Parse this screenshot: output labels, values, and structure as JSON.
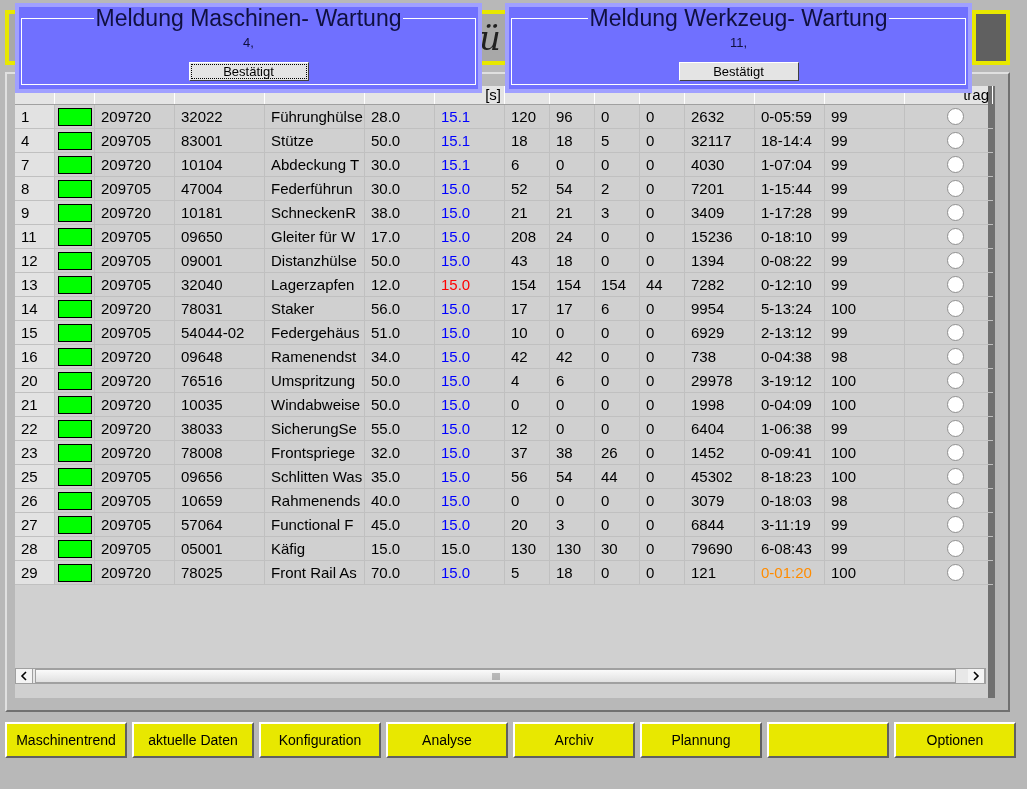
{
  "header": {
    "title": "ü"
  },
  "dialogs": [
    {
      "title": "Meldung Maschinen- Wartung",
      "message": "4,",
      "button": "Bestätigt",
      "focused": true
    },
    {
      "title": "Meldung Werkzeug- Wartung",
      "message": "11,",
      "button": "Bestätigt",
      "focused": false
    }
  ],
  "table": {
    "columns": [
      {},
      {},
      {},
      {},
      {},
      {},
      {
        "label": "[s]"
      },
      {},
      {},
      {},
      {},
      {},
      {},
      {},
      {
        "label": "trag"
      }
    ],
    "rows": [
      {
        "cells": [
          {
            "text": "1"
          },
          {
            "text": "209720"
          },
          {
            "text": "32022"
          },
          {
            "text": "Führunghülse"
          },
          {
            "text": "28.0"
          },
          {
            "text": "15.1",
            "color": "#0000ff"
          },
          {
            "text": "120"
          },
          {
            "text": "96"
          },
          {
            "text": "0"
          },
          {
            "text": "0"
          },
          {
            "text": "2632"
          },
          {
            "text": "0-05:59"
          },
          {
            "text": "99"
          }
        ],
        "indicator": {
          "color": "#00ff00"
        },
        "selected": false
      },
      {
        "cells": [
          {
            "text": "4"
          },
          {
            "text": "209705"
          },
          {
            "text": "83001"
          },
          {
            "text": "Stütze"
          },
          {
            "text": "50.0"
          },
          {
            "text": "15.1",
            "color": "#0000ff"
          },
          {
            "text": "18"
          },
          {
            "text": "18"
          },
          {
            "text": "5"
          },
          {
            "text": "0"
          },
          {
            "text": "32117"
          },
          {
            "text": "18-14:4"
          },
          {
            "text": "99"
          }
        ],
        "indicator": {
          "color": "#00ff00"
        },
        "selected": false
      },
      {
        "cells": [
          {
            "text": "7"
          },
          {
            "text": "209720"
          },
          {
            "text": "10104"
          },
          {
            "text": "Abdeckung T"
          },
          {
            "text": "30.0"
          },
          {
            "text": "15.1",
            "color": "#0000ff"
          },
          {
            "text": "6"
          },
          {
            "text": "0"
          },
          {
            "text": "0"
          },
          {
            "text": "0"
          },
          {
            "text": "4030"
          },
          {
            "text": "1-07:04"
          },
          {
            "text": "99"
          }
        ],
        "indicator": {
          "color": "#00ff00"
        },
        "selected": false
      },
      {
        "cells": [
          {
            "text": "8"
          },
          {
            "text": "209705"
          },
          {
            "text": "47004"
          },
          {
            "text": "Federführun"
          },
          {
            "text": "30.0"
          },
          {
            "text": "15.0",
            "color": "#0000ff"
          },
          {
            "text": "52"
          },
          {
            "text": "54"
          },
          {
            "text": "2"
          },
          {
            "text": "0"
          },
          {
            "text": "7201"
          },
          {
            "text": "1-15:44"
          },
          {
            "text": "99"
          }
        ],
        "indicator": {
          "color": "#00ff00"
        },
        "selected": false
      },
      {
        "cells": [
          {
            "text": "9"
          },
          {
            "text": "209720"
          },
          {
            "text": "10181"
          },
          {
            "text": "SchneckenR"
          },
          {
            "text": "38.0"
          },
          {
            "text": "15.0",
            "color": "#0000ff"
          },
          {
            "text": "21"
          },
          {
            "text": "21"
          },
          {
            "text": "3"
          },
          {
            "text": "0"
          },
          {
            "text": "3409"
          },
          {
            "text": "1-17:28"
          },
          {
            "text": "99"
          }
        ],
        "indicator": {
          "color": "#00ff00"
        },
        "selected": false
      },
      {
        "cells": [
          {
            "text": "11"
          },
          {
            "text": "209705"
          },
          {
            "text": "09650"
          },
          {
            "text": "Gleiter für W"
          },
          {
            "text": "17.0"
          },
          {
            "text": "15.0",
            "color": "#0000ff"
          },
          {
            "text": "208"
          },
          {
            "text": "24"
          },
          {
            "text": "0"
          },
          {
            "text": "0"
          },
          {
            "text": "15236"
          },
          {
            "text": "0-18:10"
          },
          {
            "text": "99"
          }
        ],
        "indicator": {
          "color": "#00ff00"
        },
        "selected": false
      },
      {
        "cells": [
          {
            "text": "12"
          },
          {
            "text": "209705"
          },
          {
            "text": "09001"
          },
          {
            "text": "Distanzhülse"
          },
          {
            "text": "50.0"
          },
          {
            "text": "15.0",
            "color": "#0000ff"
          },
          {
            "text": "43"
          },
          {
            "text": "18"
          },
          {
            "text": "0"
          },
          {
            "text": "0"
          },
          {
            "text": "1394"
          },
          {
            "text": "0-08:22"
          },
          {
            "text": "99"
          }
        ],
        "indicator": {
          "color": "#00ff00"
        },
        "selected": false
      },
      {
        "cells": [
          {
            "text": "13"
          },
          {
            "text": "209705"
          },
          {
            "text": "32040"
          },
          {
            "text": "Lagerzapfen"
          },
          {
            "text": "12.0"
          },
          {
            "text": "15.0",
            "color": "#ff0000"
          },
          {
            "text": "154"
          },
          {
            "text": "154"
          },
          {
            "text": "154"
          },
          {
            "text": "44"
          },
          {
            "text": "7282"
          },
          {
            "text": "0-12:10"
          },
          {
            "text": "99"
          }
        ],
        "indicator": {
          "color": "#00ff00"
        },
        "selected": false
      },
      {
        "cells": [
          {
            "text": "14"
          },
          {
            "text": "209720"
          },
          {
            "text": "78031"
          },
          {
            "text": "Staker"
          },
          {
            "text": "56.0"
          },
          {
            "text": "15.0",
            "color": "#0000ff"
          },
          {
            "text": "17"
          },
          {
            "text": "17"
          },
          {
            "text": "6"
          },
          {
            "text": "0"
          },
          {
            "text": "9954"
          },
          {
            "text": "5-13:24"
          },
          {
            "text": "100"
          }
        ],
        "indicator": {
          "color": "#00ff00"
        },
        "selected": false
      },
      {
        "cells": [
          {
            "text": "15"
          },
          {
            "text": "209705"
          },
          {
            "text": "54044-02"
          },
          {
            "text": "Federgehäus"
          },
          {
            "text": "51.0"
          },
          {
            "text": "15.0",
            "color": "#0000ff"
          },
          {
            "text": "10"
          },
          {
            "text": "0"
          },
          {
            "text": "0"
          },
          {
            "text": "0"
          },
          {
            "text": "6929"
          },
          {
            "text": "2-13:12"
          },
          {
            "text": "99"
          }
        ],
        "indicator": {
          "color": "#00ff00"
        },
        "selected": false
      },
      {
        "cells": [
          {
            "text": "16"
          },
          {
            "text": "209720"
          },
          {
            "text": "09648"
          },
          {
            "text": "Ramenendst"
          },
          {
            "text": "34.0"
          },
          {
            "text": "15.0",
            "color": "#0000ff"
          },
          {
            "text": "42"
          },
          {
            "text": "42"
          },
          {
            "text": "0"
          },
          {
            "text": "0"
          },
          {
            "text": "738"
          },
          {
            "text": "0-04:38"
          },
          {
            "text": "98"
          }
        ],
        "indicator": {
          "color": "#00ff00"
        },
        "selected": false
      },
      {
        "cells": [
          {
            "text": "20"
          },
          {
            "text": "209720"
          },
          {
            "text": "76516"
          },
          {
            "text": "Umspritzung"
          },
          {
            "text": "50.0"
          },
          {
            "text": "15.0",
            "color": "#0000ff"
          },
          {
            "text": "4"
          },
          {
            "text": "6"
          },
          {
            "text": "0"
          },
          {
            "text": "0"
          },
          {
            "text": "29978"
          },
          {
            "text": "3-19:12"
          },
          {
            "text": "100"
          }
        ],
        "indicator": {
          "color": "#00ff00"
        },
        "selected": false
      },
      {
        "cells": [
          {
            "text": "21"
          },
          {
            "text": "209720"
          },
          {
            "text": "10035"
          },
          {
            "text": "Windabweise"
          },
          {
            "text": "50.0"
          },
          {
            "text": "15.0",
            "color": "#0000ff"
          },
          {
            "text": "0"
          },
          {
            "text": "0"
          },
          {
            "text": "0"
          },
          {
            "text": "0"
          },
          {
            "text": "1998"
          },
          {
            "text": "0-04:09"
          },
          {
            "text": "100"
          }
        ],
        "indicator": {
          "color": "#00ff00"
        },
        "selected": false
      },
      {
        "cells": [
          {
            "text": "22"
          },
          {
            "text": "209720"
          },
          {
            "text": "38033"
          },
          {
            "text": "SicherungSe"
          },
          {
            "text": "55.0"
          },
          {
            "text": "15.0",
            "color": "#0000ff"
          },
          {
            "text": "12"
          },
          {
            "text": "0"
          },
          {
            "text": "0"
          },
          {
            "text": "0"
          },
          {
            "text": "6404"
          },
          {
            "text": "1-06:38"
          },
          {
            "text": "99"
          }
        ],
        "indicator": {
          "color": "#00ff00"
        },
        "selected": false
      },
      {
        "cells": [
          {
            "text": "23"
          },
          {
            "text": "209720"
          },
          {
            "text": "78008"
          },
          {
            "text": "Frontspriege"
          },
          {
            "text": "32.0"
          },
          {
            "text": "15.0",
            "color": "#0000ff"
          },
          {
            "text": "37"
          },
          {
            "text": "38"
          },
          {
            "text": "26"
          },
          {
            "text": "0"
          },
          {
            "text": "1452"
          },
          {
            "text": "0-09:41"
          },
          {
            "text": "100"
          }
        ],
        "indicator": {
          "color": "#00ff00"
        },
        "selected": false
      },
      {
        "cells": [
          {
            "text": "25"
          },
          {
            "text": "209705"
          },
          {
            "text": "09656"
          },
          {
            "text": "Schlitten Was"
          },
          {
            "text": "35.0"
          },
          {
            "text": "15.0",
            "color": "#0000ff"
          },
          {
            "text": "56"
          },
          {
            "text": "54"
          },
          {
            "text": "44"
          },
          {
            "text": "0"
          },
          {
            "text": "45302"
          },
          {
            "text": "8-18:23"
          },
          {
            "text": "100"
          }
        ],
        "indicator": {
          "color": "#00ff00"
        },
        "selected": false
      },
      {
        "cells": [
          {
            "text": "26"
          },
          {
            "text": "209705"
          },
          {
            "text": "10659"
          },
          {
            "text": "Rahmenends"
          },
          {
            "text": "40.0"
          },
          {
            "text": "15.0",
            "color": "#0000ff"
          },
          {
            "text": "0"
          },
          {
            "text": "0"
          },
          {
            "text": "0"
          },
          {
            "text": "0"
          },
          {
            "text": "3079"
          },
          {
            "text": "0-18:03"
          },
          {
            "text": "98"
          }
        ],
        "indicator": {
          "color": "#00ff00"
        },
        "selected": false
      },
      {
        "cells": [
          {
            "text": "27"
          },
          {
            "text": "209705"
          },
          {
            "text": "57064"
          },
          {
            "text": "Functional F"
          },
          {
            "text": "45.0"
          },
          {
            "text": "15.0",
            "color": "#0000ff"
          },
          {
            "text": "20"
          },
          {
            "text": "3"
          },
          {
            "text": "0"
          },
          {
            "text": "0"
          },
          {
            "text": "6844"
          },
          {
            "text": "3-11:19"
          },
          {
            "text": "99"
          }
        ],
        "indicator": {
          "color": "#00ff00"
        },
        "selected": false
      },
      {
        "cells": [
          {
            "text": "28"
          },
          {
            "text": "209705"
          },
          {
            "text": "05001"
          },
          {
            "text": "Käfig"
          },
          {
            "text": "15.0"
          },
          {
            "text": "15.0"
          },
          {
            "text": "130"
          },
          {
            "text": "130"
          },
          {
            "text": "30"
          },
          {
            "text": "0"
          },
          {
            "text": "79690"
          },
          {
            "text": "6-08:43"
          },
          {
            "text": "99"
          }
        ],
        "indicator": {
          "color": "#00ff00"
        },
        "selected": false
      },
      {
        "cells": [
          {
            "text": "29"
          },
          {
            "text": "209720"
          },
          {
            "text": "78025"
          },
          {
            "text": "Front Rail As"
          },
          {
            "text": "70.0"
          },
          {
            "text": "15.0",
            "color": "#0000ff"
          },
          {
            "text": "5"
          },
          {
            "text": "18"
          },
          {
            "text": "0"
          },
          {
            "text": "0"
          },
          {
            "text": "121"
          },
          {
            "text": "0-01:20",
            "color": "#ff8c00"
          },
          {
            "text": "100"
          }
        ],
        "indicator": {
          "color": "#00ff00"
        },
        "selected": false
      }
    ]
  },
  "buttons": [
    {
      "kind": "label",
      "label": "Maschinentrend"
    },
    {
      "kind": "label",
      "label": "aktuelle Daten"
    },
    {
      "kind": "label",
      "label": "Konfiguration"
    },
    {
      "kind": "label",
      "label": "Analyse"
    },
    {
      "kind": "label",
      "label": "Archiv"
    },
    {
      "kind": "label",
      "label": "Plannung"
    },
    {
      "kind": "blank"
    },
    {
      "kind": "label",
      "label": "Optionen"
    }
  ]
}
